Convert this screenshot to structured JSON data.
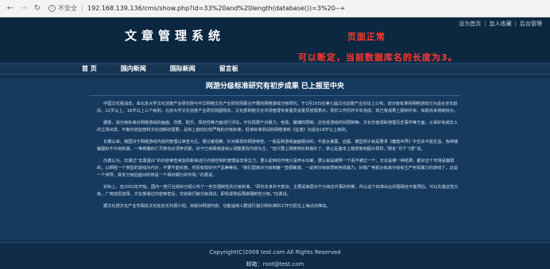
{
  "browser": {
    "back_icon": "arrow-left-icon",
    "forward_icon": "arrow-right-icon",
    "reload_icon": "reload-icon",
    "security_label": "不安全",
    "url": "192.168.139.136/cms/show.php?id=33%20and%20length(database())=3%20--+"
  },
  "header": {
    "top_links": [
      "设为首页",
      "加入收藏",
      "后台管理"
    ],
    "logo_text": "文章管理系统",
    "annotation_line1": "页面正常",
    "annotation_line2": "可以断定，当前数据库名的长度为3。"
  },
  "nav": {
    "items": [
      "首 页",
      "国内新闻",
      "国际新闻",
      "留言板"
    ]
  },
  "article": {
    "title": "网游分级标准研究有初步成果 已上报至中央",
    "paragraphs": [
      "中国文化报消息，由北京大学文化创意产业研究院与中华网络文化产业研究院联合开展的网络游戏分级研究，于1月10日在第七届文化创意产业论坛上公布。该分级标准将网络游戏分为适合全年龄段、12岁以上、18岁以上三个级别。北京大学文化创意产业研究院副院长、文化部网络文化市场管理专家委员会委员张振表示，研究工作历时半年完成，现已将成果上报到中央，目前尚未得到批示。",
      "据悉，该分级标准对网络游戏的画面、背景、配乐、规范性等方面进行评估，不仅局限于对暴力、色情、赌博的限制，还包括游戏时间限制等。文化价值观和地理历史事件等方面，从保护未成年人的立场出发，平衡内容监管和文化创新的需要，总体上趋向比较严格的分级标准。经该标准测试的网络游戏《征途》为适合18岁以上级别。",
      "长期以来，我国对于网络游戏内容的管理以审查为主。据记者观察，针对频发的网游审查，一般是和游戏画面相对的，不能太暴露、血腥、典型例子就是要求《魔兽世界》中击杀不能见血、各种接触图标不许有刺激，一堆骨骼的亡灵族也必须穿衣服，对于已有网络游戏以调整更改内容为主。“但只要上网搜搜反和谐补丁，禁止后基本上能恢复到图片原样。”网友“月下飞雪”说。",
      "向勇认为，仅通过“去黑留白”的内容审查来监机制来进行内容控制的管理会非常乏力，要么起到的作用只是杯水车薪，要么就是被弄一下而不被过一个，无论是哪一种结果，都对这个市场是偏弱的，以牺牲一个类型的游戏为代价，不要不能实施、然而有较好中产品等等好。“我们国家对分级制度一直很敏感，一说到分级就想到色情暴力，好像广电视台有高分级有生产色情暴力的游戏了，这是一个误导。其实分级后面对的将是一个相对细分的市场。”向勇说。",
      "实际上，自2002年开始，国内一些行业组织已经公布了一些非强制性的分级标准。“研究本身并不复杂，主要是高层对于分级这件事的判断，所以这个标准出台的阻碍还不能预估。可以先建议性分级，广商自愿选择，文化部通过内容审查后，交给我们做分级测试，即机成熟后再做强制性分级。”向勇说。",
      "据文化部文化产业司相关文化处处长刘振介绍，目前对网游内容、功能适用人群进行指引和标准的工作已经在上海试点推动。"
    ]
  },
  "footer": {
    "copyright": "Copyright(C)2009 test.com All Rights Reserved",
    "email": "邮箱：root@test.com"
  }
}
